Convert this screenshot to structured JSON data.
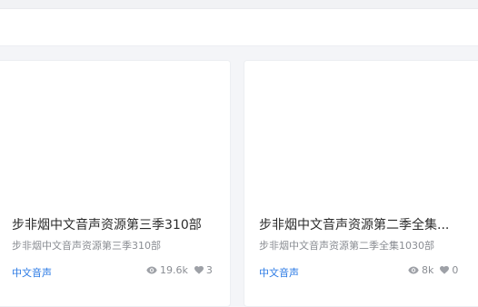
{
  "cards": [
    {
      "title": "步非烟中文音声资源第三季310部",
      "subtitle": "步非烟中文音声资源第三季310部",
      "category": "中文音声",
      "views": "19.6k",
      "likes": "3",
      "view_icon": "eye-icon",
      "like_icon": "heart-icon"
    },
    {
      "title": "步非烟中文音声资源第二季全集...",
      "subtitle": "步非烟中文音声资源第二季全集1030部",
      "category": "中文音声",
      "views": "8k",
      "likes": "0",
      "view_icon": "eye-icon",
      "like_icon": "heart-icon"
    }
  ],
  "colors": {
    "accent": "#2c7be5",
    "muted": "#8a8d93",
    "title": "#2b2b2b"
  }
}
